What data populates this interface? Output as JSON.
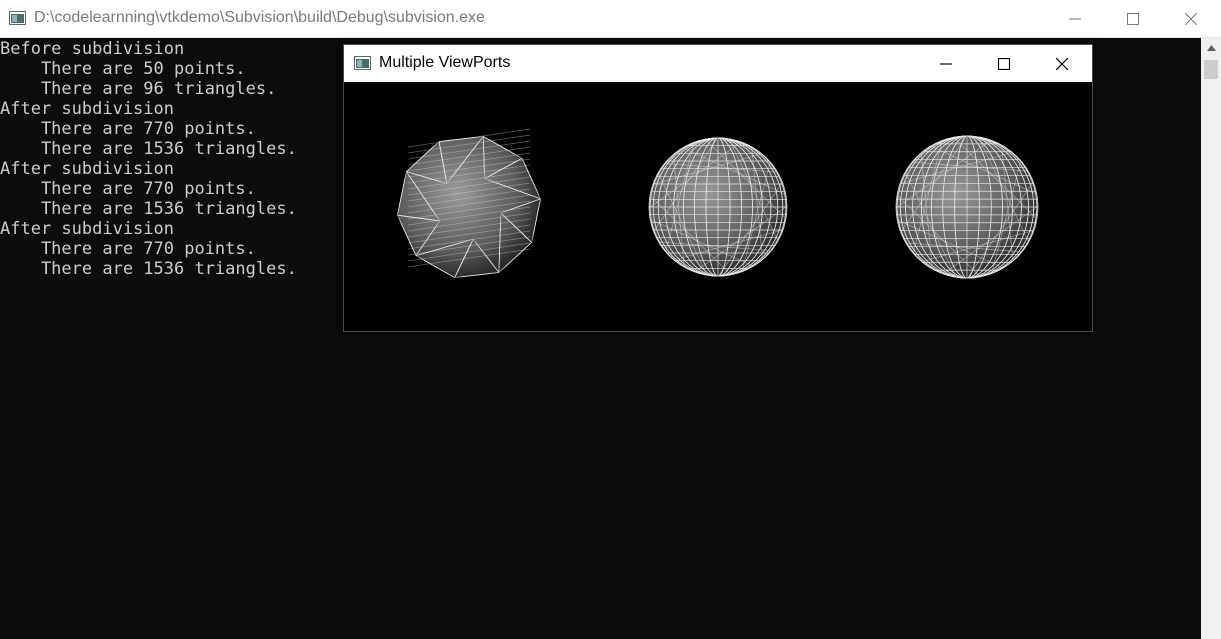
{
  "console_window": {
    "title": "D:\\codelearnning\\vtkdemo\\Subvision\\build\\Debug\\subvision.exe",
    "icon": "console-app-icon",
    "buttons": [
      "minimize-icon",
      "maximize-icon",
      "close-icon"
    ]
  },
  "console_output": {
    "lines": [
      "Before subdivision",
      "    There are 50 points.",
      "    There are 96 triangles.",
      "After subdivision",
      "    There are 770 points.",
      "    There are 1536 triangles.",
      "After subdivision",
      "    There are 770 points.",
      "    There are 1536 triangles.",
      "After subdivision",
      "    There are 770 points.",
      "    There are 1536 triangles."
    ]
  },
  "render_window": {
    "title": "Multiple ViewPorts",
    "icon": "vtk-app-icon",
    "buttons": [
      "minimize-icon",
      "maximize-icon",
      "close-icon"
    ],
    "viewports": [
      {
        "name": "viewport-original-mesh",
        "shape": "icosahedral wireframe"
      },
      {
        "name": "viewport-subdivided-mesh-1",
        "shape": "sphere wireframe"
      },
      {
        "name": "viewport-subdivided-mesh-2",
        "shape": "sphere wireframe"
      }
    ]
  },
  "colors": {
    "console_bg": "#0c0c0c",
    "console_text": "#cccccc",
    "titlebar_bg": "#ffffff",
    "render_bg": "#000000",
    "mesh_stroke": "#e6e6e6"
  }
}
